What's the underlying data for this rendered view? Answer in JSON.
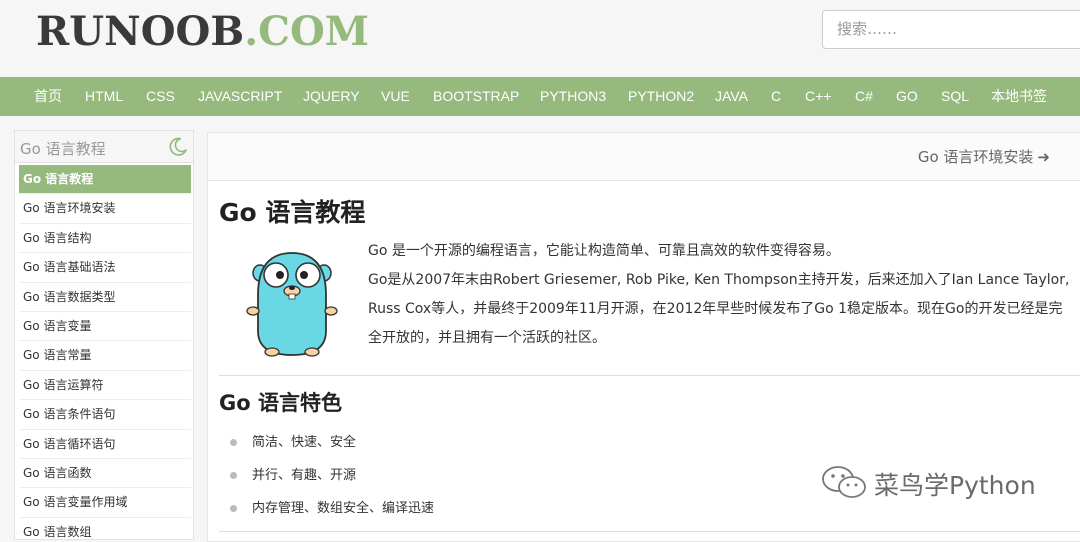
{
  "header": {
    "logo_main": "RUNOOB",
    "logo_suffix": ".COM",
    "search_placeholder": "搜索……"
  },
  "nav": {
    "items": [
      "首页",
      "HTML",
      "CSS",
      "JAVASCRIPT",
      "JQUERY",
      "VUE",
      "BOOTSTRAP",
      "PYTHON3",
      "PYTHON2",
      "JAVA",
      "C",
      "C++",
      "C#",
      "GO",
      "SQL",
      "本地书签"
    ]
  },
  "sidebar": {
    "title": "Go 语言教程",
    "items": [
      "Go 语言教程",
      "Go 语言环境安装",
      "Go 语言结构",
      "Go 语言基础语法",
      "Go 语言数据类型",
      "Go 语言变量",
      "Go 语言常量",
      "Go 语言运算符",
      "Go 语言条件语句",
      "Go 语言循环语句",
      "Go 语言函数",
      "Go 语言变量作用域",
      "Go 语言数组"
    ],
    "active_index": 0
  },
  "main": {
    "next_link": "Go 语言环境安装",
    "title": "Go 语言教程",
    "intro_line1": "Go 是一个开源的编程语言，它能让构造简单、可靠且高效的软件变得容易。",
    "intro_line2": "Go是从2007年末由Robert Griesemer, Rob Pike, Ken Thompson主持开发，后来还加入了Ian Lance Taylor, Russ Cox等人，并最终于2009年11月开源，在2012年早些时候发布了Go 1稳定版本。现在Go的开发已经是完全开放的，并且拥有一个活跃的社区。",
    "features_title": "Go 语言特色",
    "features": [
      "简洁、快速、安全",
      "并行、有趣、开源",
      "内存管理、数组安全、编译迅速"
    ]
  },
  "watermark": {
    "text": "菜鸟学Python"
  },
  "colors": {
    "accent": "#96b97d",
    "logo_dark": "#3a3a3a"
  }
}
